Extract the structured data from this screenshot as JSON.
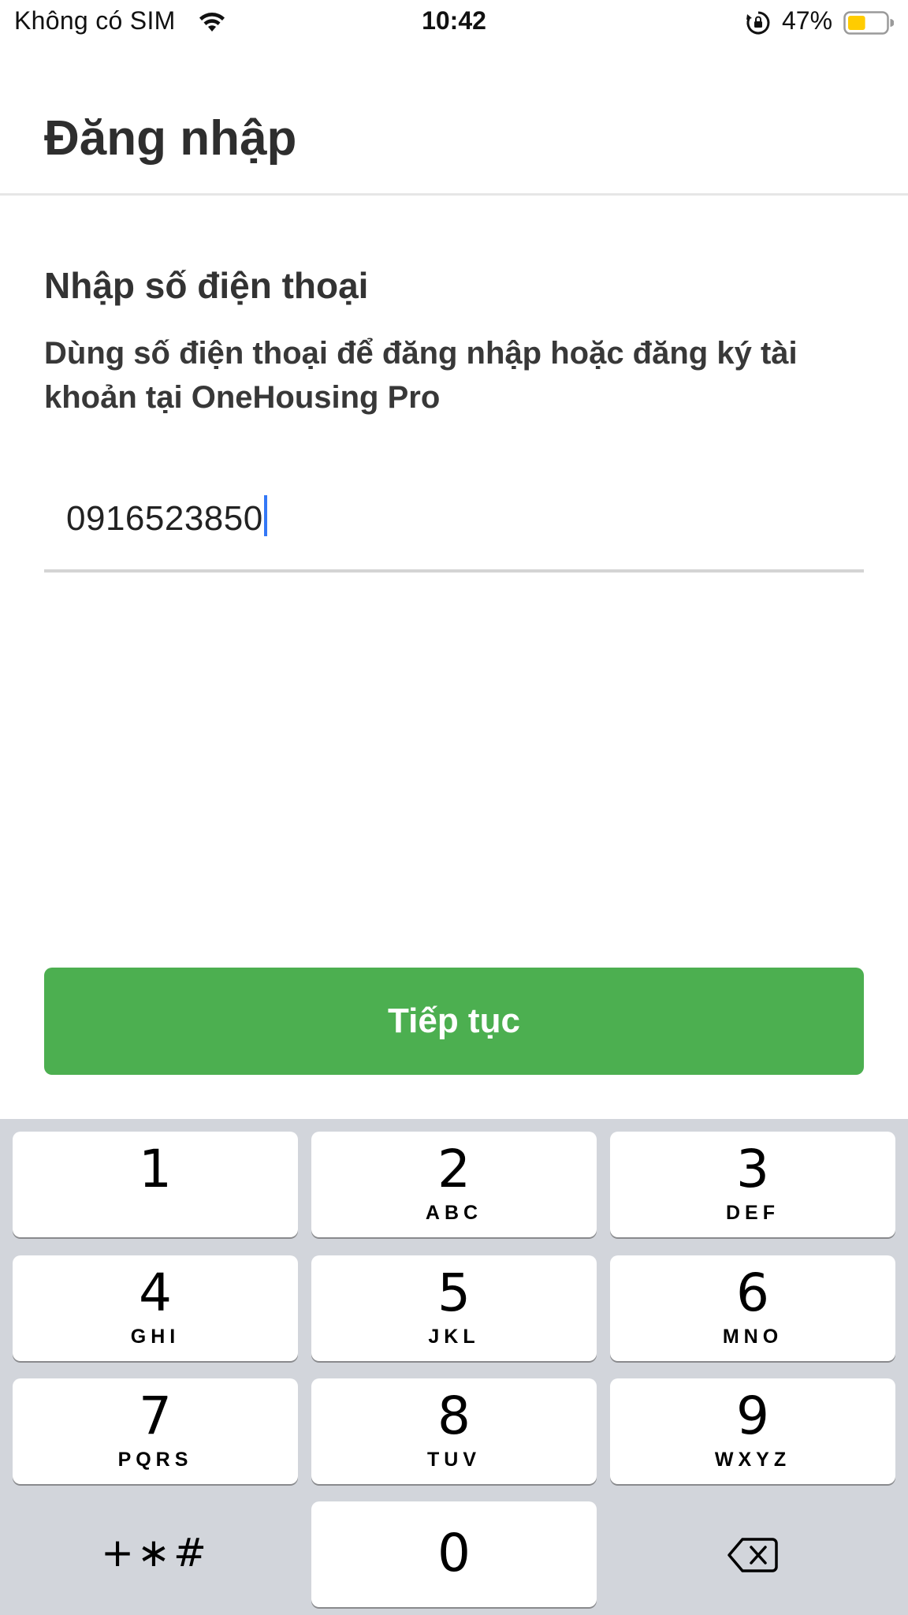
{
  "status_bar": {
    "carrier": "Không có SIM",
    "time": "10:42",
    "battery_percent": "47%",
    "battery_level": 0.47,
    "icons": [
      "wifi-icon",
      "orientation-lock-icon",
      "battery-icon"
    ]
  },
  "header": {
    "title": "Đăng nhập"
  },
  "form": {
    "section_title": "Nhập số điện thoại",
    "description": "Dùng số điện thoại để đăng nhập hoặc đăng ký tài khoản tại OneHousing Pro",
    "phone_value": "0916523850"
  },
  "continue_button": {
    "label": "Tiếp tục"
  },
  "keypad": {
    "keys": [
      {
        "digit": "1",
        "letters": ""
      },
      {
        "digit": "2",
        "letters": "ABC"
      },
      {
        "digit": "3",
        "letters": "DEF"
      },
      {
        "digit": "4",
        "letters": "GHI"
      },
      {
        "digit": "5",
        "letters": "JKL"
      },
      {
        "digit": "6",
        "letters": "MNO"
      },
      {
        "digit": "7",
        "letters": "PQRS"
      },
      {
        "digit": "8",
        "letters": "TUV"
      },
      {
        "digit": "9",
        "letters": "WXYZ"
      },
      {
        "digit": "0",
        "letters": ""
      }
    ],
    "symbols_label": "+∗#",
    "backspace_icon": "backspace-icon"
  },
  "colors": {
    "accent_green": "#4caf50",
    "caret_blue": "#3478f6",
    "battery_yellow": "#ffcc00",
    "keyboard_bg": "#d2d5db"
  }
}
